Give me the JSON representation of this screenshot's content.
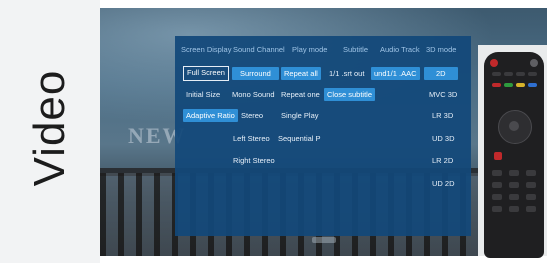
{
  "side_label": "Video",
  "background_text": "NEW",
  "menu": {
    "headers": [
      "Screen Display",
      "Sound Channel",
      "Play mode",
      "Subtitle",
      "Audio Track",
      "3D mode"
    ],
    "screen_display": [
      "Full Screen",
      "Initial Size",
      "Adaptive Ratio"
    ],
    "sound_channel": [
      "Surround",
      "Mono Sound",
      "Stereo",
      "Left Stereo",
      "Right Stereo"
    ],
    "play_mode": [
      "Repeat all",
      "Repeat one",
      "Single Play",
      "Sequential P"
    ],
    "subtitle": [
      "1/1 .srt out",
      "Close subtitle"
    ],
    "audio_track": [
      "und1/1 .AAC"
    ],
    "mode_3d": [
      "2D",
      "MVC 3D",
      "LR 3D",
      "UD 3D",
      "LR 2D",
      "UD 2D"
    ]
  },
  "colors": {
    "menu_bg": "#12487a",
    "selected": "#2f8fd6",
    "header_text": "#9fc4e6"
  }
}
